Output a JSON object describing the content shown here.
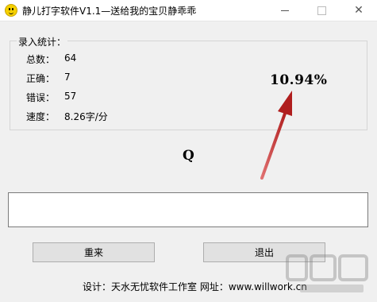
{
  "window": {
    "title": "静儿打字软件V1.1—送给我的宝贝静乖乖",
    "controls": {
      "minimize": "—",
      "maximize": "□",
      "close": "✕"
    }
  },
  "stats": {
    "group_label": "录入统计：",
    "items": [
      {
        "label": "总数：",
        "value": "64"
      },
      {
        "label": "正确：",
        "value": "7"
      },
      {
        "label": "错误：",
        "value": "57"
      },
      {
        "label": "速度：",
        "value": "8.26字/分"
      }
    ]
  },
  "accuracy": {
    "text": "10.94%",
    "arrow_color": "#c0392b"
  },
  "target_char": "Q",
  "input": {
    "value": ""
  },
  "buttons": {
    "restart": "重来",
    "exit": "退出"
  },
  "footer": "设计：天水无忧软件工作室   网址：www.willwork.cn",
  "icons": [
    "smiley-app-icon",
    "minimize-icon",
    "maximize-icon",
    "close-icon",
    "red-arrow",
    "watermark-logo"
  ]
}
